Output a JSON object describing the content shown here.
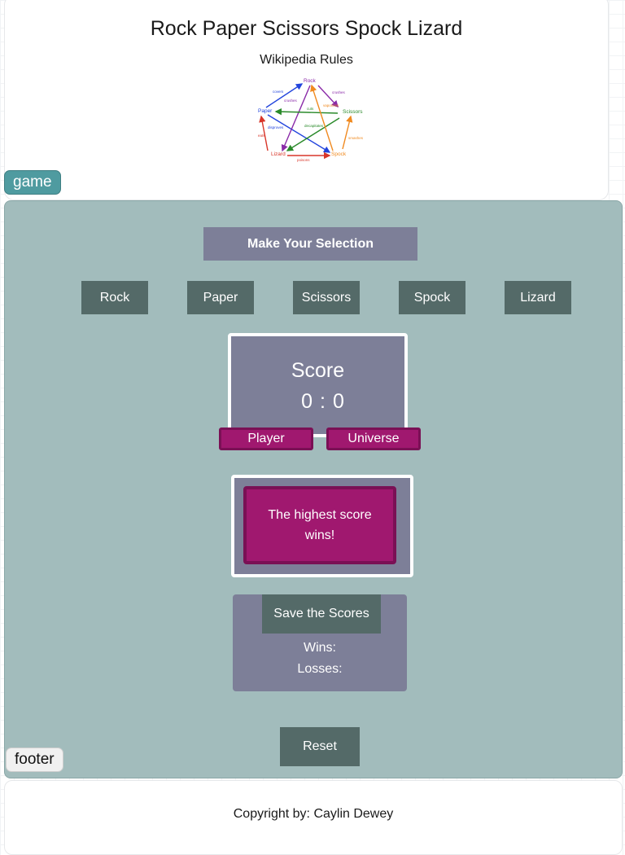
{
  "header": {
    "title": "Rock Paper Scissors Spock Lizard",
    "subtitle": "Wikipedia Rules",
    "diagram": {
      "nodes": [
        "Rock",
        "Paper",
        "Scissors",
        "Spock",
        "Lizard"
      ],
      "verbs": [
        "covers",
        "crushes",
        "cuts",
        "crushes",
        "vaporizes",
        "decapitates",
        "disproves",
        "eats",
        "smashes",
        "poisons"
      ],
      "colors": {
        "blue": "#2244dd",
        "purple": "#8a2aa8",
        "green": "#2a8a2a",
        "orange": "#f08a20",
        "red": "#d8362a"
      }
    }
  },
  "tags": {
    "game": "game",
    "footer": "footer"
  },
  "game": {
    "selection_header": "Make Your Selection",
    "choices": [
      "Rock",
      "Paper",
      "Scissors",
      "Spock",
      "Lizard"
    ],
    "score": {
      "label": "Score",
      "player": "0",
      "separator": ":",
      "universe": "0",
      "player_label": "Player",
      "universe_label": "Universe"
    },
    "result_message": "The highest score wins!",
    "saves": {
      "button": "Save the Scores",
      "wins_label": "Wins:",
      "losses_label": "Losses:"
    },
    "reset": "Reset"
  },
  "footer": {
    "copyright": "Copyright by: Caylin Dewey"
  },
  "colors": {
    "game_bg": "#a2bcbc",
    "panel": "#7d7f98",
    "button": "#546a68",
    "accent": "#a0186f",
    "tag_game": "#4f9ba0"
  }
}
